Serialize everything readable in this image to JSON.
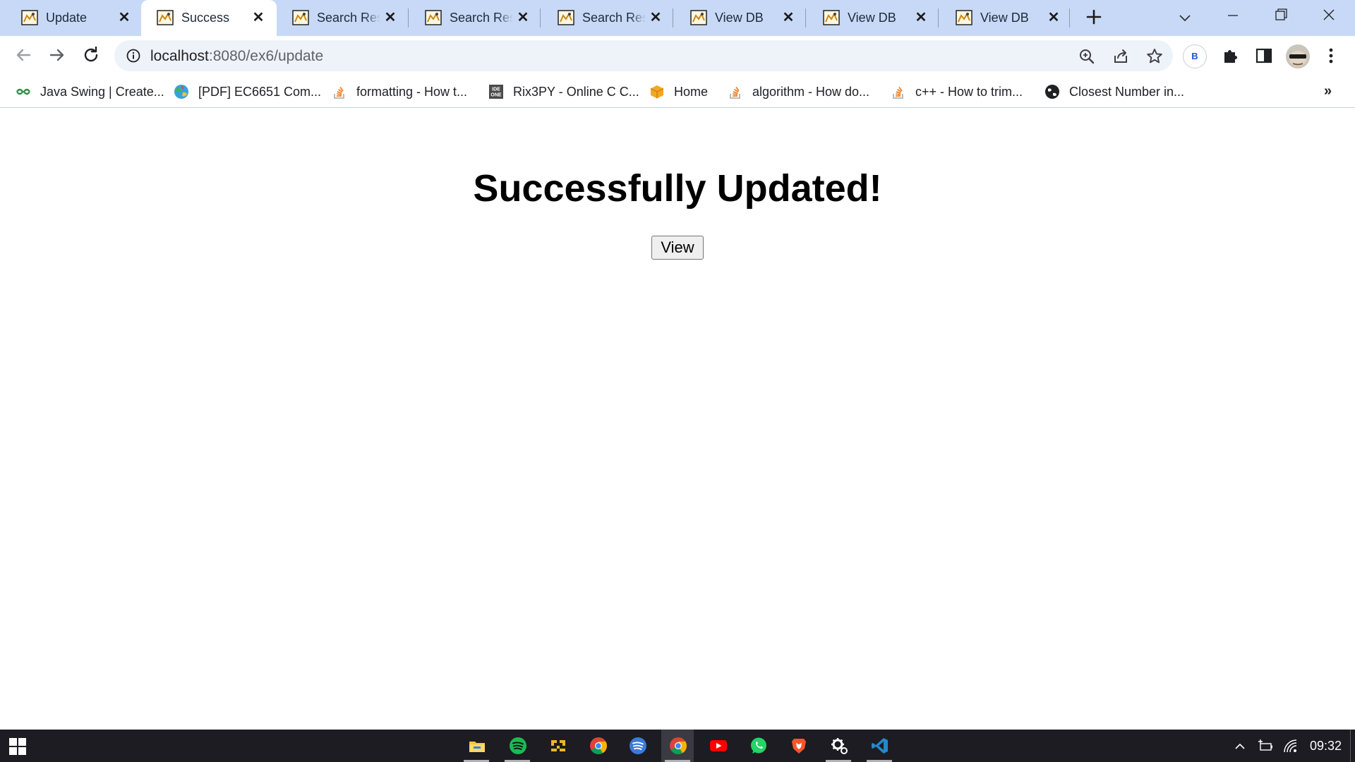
{
  "browser": {
    "tabs": [
      {
        "title": "Update",
        "active": false
      },
      {
        "title": "Success",
        "active": true
      },
      {
        "title": "Search Results",
        "active": false
      },
      {
        "title": "Search Results",
        "active": false
      },
      {
        "title": "Search Results",
        "active": false
      },
      {
        "title": "View DB",
        "active": false
      },
      {
        "title": "View DB",
        "active": false
      },
      {
        "title": "View DB",
        "active": false
      }
    ],
    "address_bar": {
      "host": "localhost",
      "path": ":8080/ex6/update"
    },
    "profile_badge": "B",
    "bookmarks": [
      {
        "label": "Java Swing | Create...",
        "icon": "gfg-icon"
      },
      {
        "label": "[PDF] EC6651 Com...",
        "icon": "globe-color-icon"
      },
      {
        "label": "formatting - How t...",
        "icon": "stackoverflow-icon"
      },
      {
        "label": "Rix3PY - Online C C...",
        "icon": "ideone-icon"
      },
      {
        "label": "Home",
        "icon": "box-icon"
      },
      {
        "label": "algorithm - How do...",
        "icon": "stackoverflow-icon"
      },
      {
        "label": "c++ - How to trim...",
        "icon": "stackoverflow-icon"
      },
      {
        "label": "Closest Number in...",
        "icon": "globe-dark-icon"
      }
    ],
    "bookmarks_overflow": "»"
  },
  "page": {
    "heading": "Successfully Updated!",
    "view_button_label": "View"
  },
  "taskbar": {
    "apps": [
      "file-explorer-icon",
      "spotify-icon",
      "git-icon",
      "chrome-icon",
      "spotify-alt-icon",
      "chrome-active-icon",
      "youtube-icon",
      "whatsapp-icon",
      "brave-icon",
      "settings-icon",
      "vscode-icon"
    ],
    "clock": "09:32"
  },
  "colors": {
    "tabstrip_bg": "#c7d9f6",
    "omnibox_bg": "#eef2f9",
    "taskbar_bg": "#1c1c22"
  }
}
